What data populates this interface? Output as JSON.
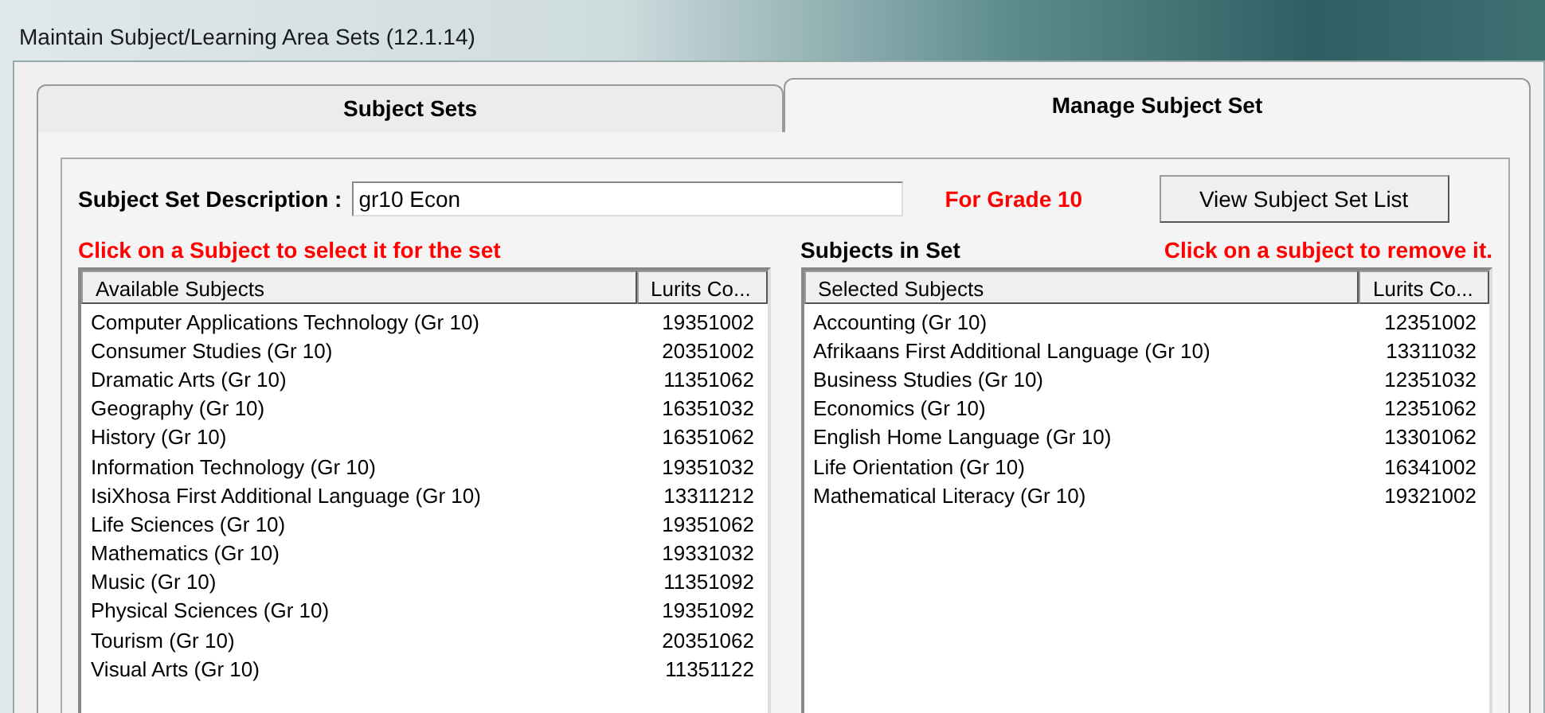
{
  "window": {
    "title": "Maintain Subject/Learning Area Sets (12.1.14)"
  },
  "tabs": [
    {
      "label": "Subject Sets",
      "selected": false
    },
    {
      "label": "Manage Subject Set",
      "selected": true
    }
  ],
  "description": {
    "label": "Subject Set Description :",
    "value": "gr10 Econ"
  },
  "grade_note": "For Grade 10",
  "view_button": "View Subject Set List",
  "available": {
    "instruction": "Click on a Subject to select it for the set",
    "columns": [
      "Available Subjects",
      "Lurits Co..."
    ],
    "rows": [
      [
        "Computer Applications Technology (Gr 10)",
        "19351002"
      ],
      [
        "Consumer Studies (Gr 10)",
        "20351002"
      ],
      [
        "Dramatic Arts (Gr 10)",
        "11351062"
      ],
      [
        "Geography (Gr 10)",
        "16351032"
      ],
      [
        "History (Gr 10)",
        "16351062"
      ],
      [
        "Information Technology (Gr 10)",
        "19351032"
      ],
      [
        "IsiXhosa First Additional Language (Gr 10)",
        "13311212"
      ],
      [
        "Life Sciences (Gr 10)",
        "19351062"
      ],
      [
        "Mathematics (Gr 10)",
        "19331032"
      ],
      [
        "Music (Gr 10)",
        "11351092"
      ],
      [
        "Physical Sciences (Gr 10)",
        "19351092"
      ],
      [
        "Tourism (Gr 10)",
        "20351062"
      ],
      [
        "Visual Arts (Gr 10)",
        "11351122"
      ]
    ]
  },
  "in_set": {
    "heading": "Subjects in Set",
    "instruction": "Click on a subject to remove it.",
    "columns": [
      "Selected Subjects",
      "Lurits Co..."
    ],
    "rows": [
      [
        "Accounting (Gr 10)",
        "12351002"
      ],
      [
        "Afrikaans First Additional Language (Gr 10)",
        "13311032"
      ],
      [
        "Business Studies (Gr 10)",
        "12351032"
      ],
      [
        "Economics (Gr 10)",
        "12351062"
      ],
      [
        "English Home Language (Gr 10)",
        "13301062"
      ],
      [
        "Life Orientation (Gr 10)",
        "16341002"
      ],
      [
        "Mathematical Literacy (Gr 10)",
        "19321002"
      ]
    ]
  }
}
